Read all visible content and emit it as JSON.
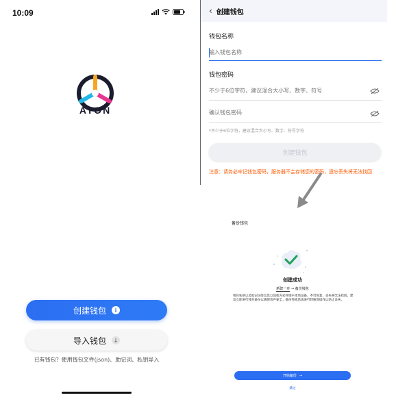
{
  "status": {
    "time": "10:09"
  },
  "welcome": {
    "logo_text": "ATON",
    "create_button": "创建钱包",
    "create_info_icon": "i",
    "import_button": "导入钱包",
    "import_icon": "↓",
    "hint": "已有钱包？使用钱包文件(json)、助记词、私钥导入"
  },
  "create_form": {
    "nav_title": "创建钱包",
    "name_label": "钱包名称",
    "name_placeholder": "输入钱包名称",
    "password_label": "钱包密码",
    "password_placeholder": "不少于6位字符，建议混合大小写、数字、符号",
    "confirm_placeholder": "确认钱包密码",
    "small_hint": "*不少于6位字符，建议混合大小写、数字、符号字符",
    "submit_button": "创建钱包",
    "warning": "注意：请务必牢记钱包密码，服务器不会存储您的密码，遗忘丢失将无法找回"
  },
  "backup": {
    "page_title": "备份钱包",
    "success_title": "创建成功",
    "step_one": "新建一步",
    "step_two": "备份钱包",
    "description": "钱包私钥以及助记词等信息以加密方式存储于本地设备，不可恢复，丢失将无法找回。建议立即进行钱包备份以确保资产安全，备份完成后再进行转账等操作以防止丢失。",
    "backup_button": "开始备份",
    "backup_arrow": "→",
    "skip_link": "跳过"
  },
  "colors": {
    "primary": "#2c6ef2",
    "warning": "#ff5a00",
    "success": "#1ca35a"
  }
}
